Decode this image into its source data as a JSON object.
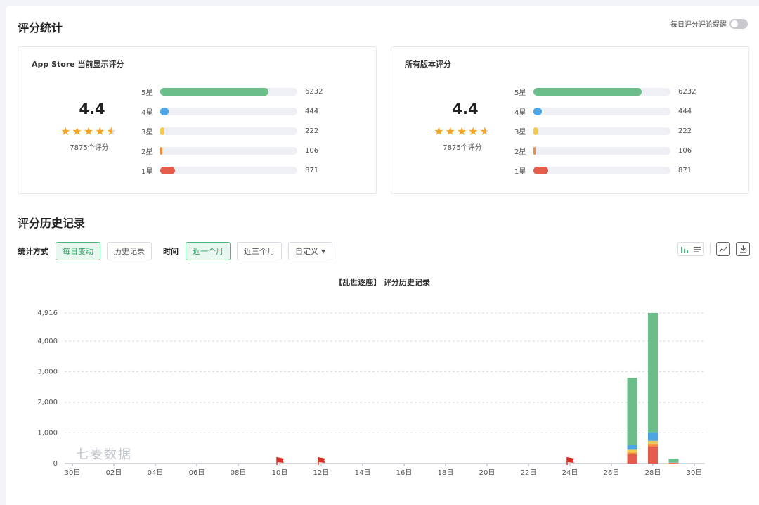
{
  "header": {
    "title": "评分统计",
    "toggle_label": "每日评分评论提醒"
  },
  "cards": [
    {
      "title": "App Store 当前显示评分",
      "score": "4.4",
      "count": "7875个评分",
      "rows": [
        {
          "label": "5星",
          "value": "6232",
          "fraction": 0.79,
          "color": "#6bbd8a"
        },
        {
          "label": "4星",
          "value": "444",
          "fraction": 0.06,
          "color": "#4ea5e6"
        },
        {
          "label": "3星",
          "value": "222",
          "fraction": 0.03,
          "color": "#f2c94c"
        },
        {
          "label": "2星",
          "value": "106",
          "fraction": 0.015,
          "color": "#f08c3a"
        },
        {
          "label": "1星",
          "value": "871",
          "fraction": 0.11,
          "color": "#e35c4c"
        }
      ]
    },
    {
      "title": "所有版本评分",
      "score": "4.4",
      "count": "7875个评分",
      "rows": [
        {
          "label": "5星",
          "value": "6232",
          "fraction": 0.79,
          "color": "#6bbd8a"
        },
        {
          "label": "4星",
          "value": "444",
          "fraction": 0.06,
          "color": "#4ea5e6"
        },
        {
          "label": "3星",
          "value": "222",
          "fraction": 0.03,
          "color": "#f2c94c"
        },
        {
          "label": "2星",
          "value": "106",
          "fraction": 0.015,
          "color": "#f08c3a"
        },
        {
          "label": "1星",
          "value": "871",
          "fraction": 0.11,
          "color": "#e35c4c"
        }
      ]
    }
  ],
  "history": {
    "title": "评分历史记录",
    "method_label": "统计方式",
    "method_options": [
      "每日变动",
      "历史记录"
    ],
    "time_label": "时间",
    "time_options": [
      "近一个月",
      "近三个月"
    ],
    "custom_label": "自定义"
  },
  "watermark": "七麦数据",
  "chart_data": {
    "type": "bar",
    "stacked": true,
    "title": "【乱世逐鹿】 评分历史记录",
    "xlabel": "",
    "ylabel": "",
    "ylim": [
      0,
      4916
    ],
    "yticks": [
      "0",
      "1,000",
      "2,000",
      "3,000",
      "4,000",
      "4,916"
    ],
    "ytick_values": [
      0,
      1000,
      2000,
      3000,
      4000,
      4916
    ],
    "xticks": [
      "30日",
      "02日",
      "04日",
      "06日",
      "08日",
      "10日",
      "12日",
      "14日",
      "16日",
      "18日",
      "20日",
      "22日",
      "24日",
      "26日",
      "28日",
      "30日"
    ],
    "xtick_days": [
      0,
      2,
      4,
      6,
      8,
      10,
      12,
      14,
      16,
      18,
      20,
      22,
      24,
      26,
      28,
      30
    ],
    "flag_days": [
      10,
      12,
      24
    ],
    "flag_color": "#d93025",
    "grid": true,
    "series": [
      {
        "color": "#e35c4c",
        "x": [
          27,
          28,
          29
        ],
        "values": [
          300,
          560,
          20
        ]
      },
      {
        "color": "#f08c3a",
        "x": [
          27,
          28,
          29
        ],
        "values": [
          60,
          80,
          5
        ]
      },
      {
        "color": "#f2c94c",
        "x": [
          27,
          28,
          29
        ],
        "values": [
          90,
          100,
          5
        ]
      },
      {
        "color": "#4ea5e6",
        "x": [
          27,
          28,
          29
        ],
        "values": [
          150,
          280,
          10
        ]
      },
      {
        "color": "#6bbd8a",
        "x": [
          27,
          28,
          29
        ],
        "values": [
          2200,
          3896,
          120
        ]
      }
    ]
  }
}
